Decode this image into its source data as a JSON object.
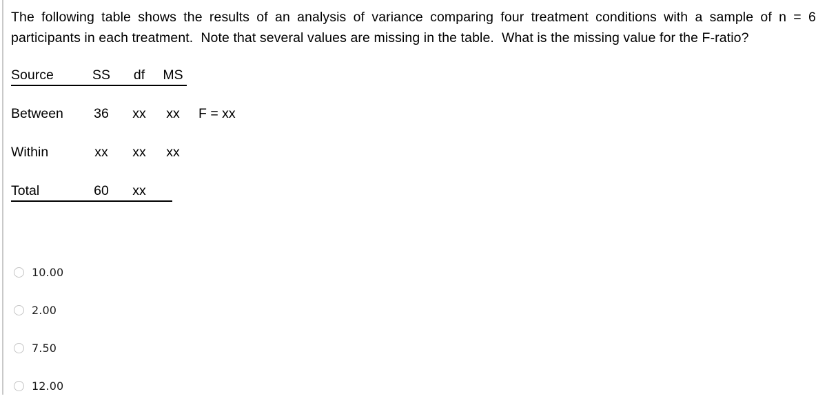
{
  "question": {
    "line1": "The following table shows the results of an analysis of variance comparing four treatment conditions with a sample of n = 6",
    "line2": "participants in each treatment.  Note that several values are missing in the table.  What is the missing value for the F-ratio?"
  },
  "table": {
    "header": {
      "source": "Source",
      "ss": "SS",
      "df": "df",
      "ms": "MS"
    },
    "rows": [
      {
        "source": "Between",
        "ss": "36",
        "df": "xx",
        "ms": "xx",
        "f": "F = xx"
      },
      {
        "source": "Within",
        "ss": "xx",
        "df": "xx",
        "ms": "xx",
        "f": ""
      },
      {
        "source": "Total",
        "ss": "60",
        "df": "xx",
        "ms": "",
        "f": ""
      }
    ]
  },
  "options": [
    {
      "label": "10.00"
    },
    {
      "label": "2.00"
    },
    {
      "label": "7.50"
    },
    {
      "label": "12.00"
    }
  ],
  "colors": {
    "text": "#000000",
    "option_text": "#1c1c1c",
    "radio_border": "#c4c4c4",
    "left_rule": "#c9c9c9",
    "background": "#ffffff"
  }
}
